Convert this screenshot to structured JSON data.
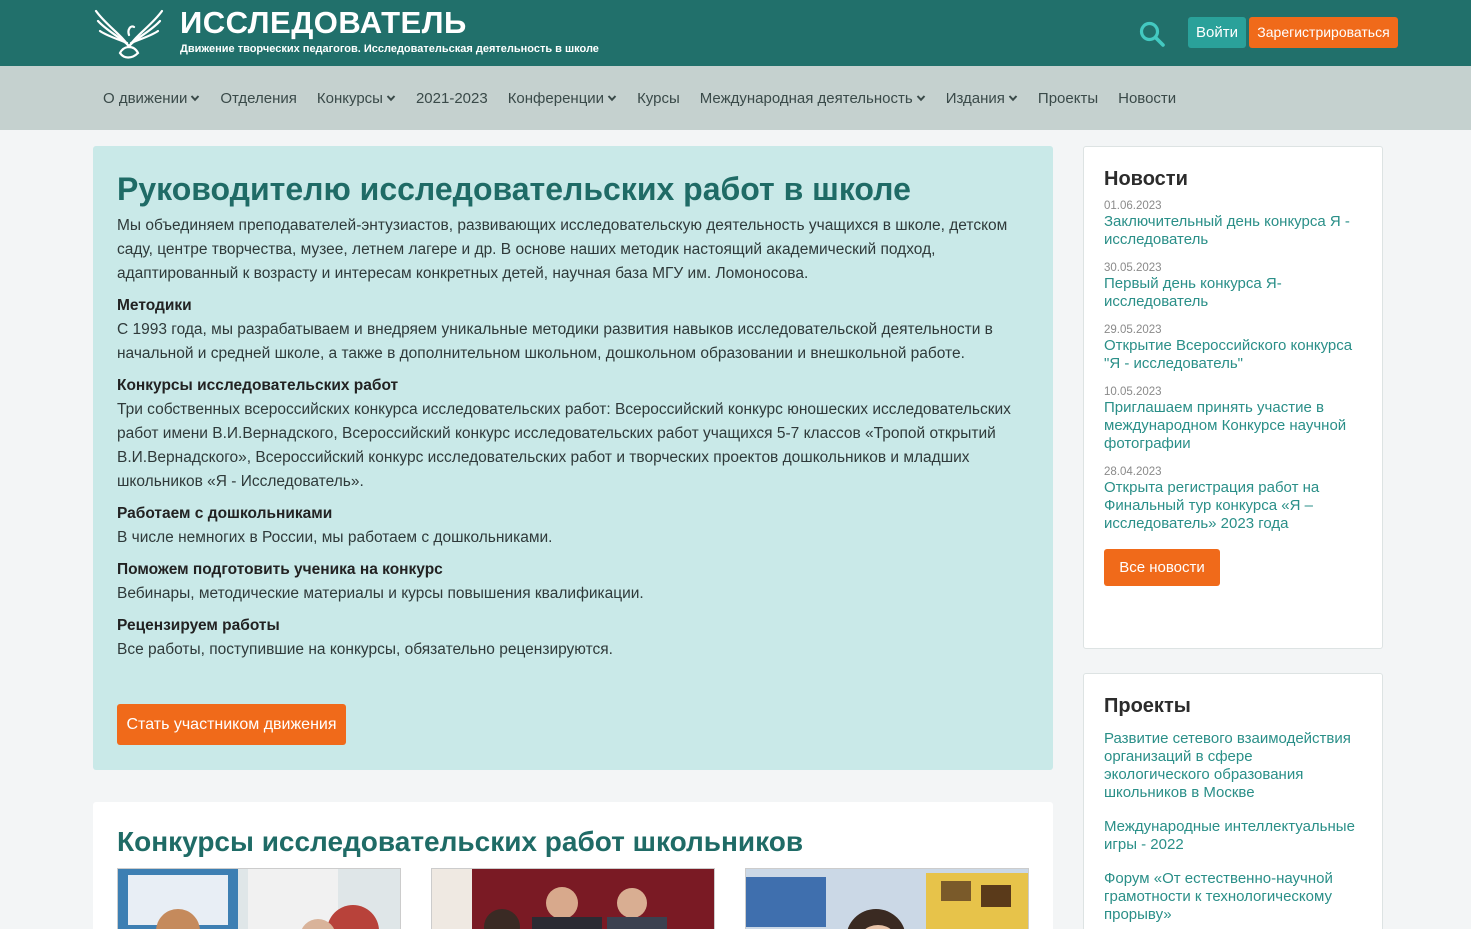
{
  "header": {
    "title": "ИССЛЕДОВАТЕЛЬ",
    "subtitle": "Движение творческих педагогов. Исследовательская деятельность в школе",
    "login": "Войти",
    "register": "Зарегистрироваться"
  },
  "nav": [
    {
      "label": "О движении",
      "dropdown": true
    },
    {
      "label": "Отделения",
      "dropdown": false
    },
    {
      "label": "Конкурсы",
      "dropdown": true
    },
    {
      "label": "2021-2023",
      "dropdown": false
    },
    {
      "label": "Конференции",
      "dropdown": true
    },
    {
      "label": "Курсы",
      "dropdown": false
    },
    {
      "label": "Международная деятельность",
      "dropdown": true
    },
    {
      "label": "Издания",
      "dropdown": true
    },
    {
      "label": "Проекты",
      "dropdown": false
    },
    {
      "label": "Новости",
      "dropdown": false
    }
  ],
  "main": {
    "title": "Руководителю исследовательских работ в школе",
    "intro": "Мы объединяем преподавателей-энтузиастов, развивающих исследовательскую деятельность учащихся в школе, детском саду, центре творчества, музее, летнем лагере и др. В основе наших методик настоящий академический подход, адаптированный к возрасту и интересам конкретных детей, научная база МГУ им. Ломоносова.",
    "sections": [
      {
        "title": "Методики",
        "text": "С 1993 года, мы разрабатываем и внедряем уникальные методики развития навыков исследовательской деятельности в начальной и средней школе, а также в дополнительном школьном, дошкольном образовании и внешкольной работе."
      },
      {
        "title": "Конкурсы исследовательских работ",
        "text": "Три собственных всероссийских конкурса исследовательских работ: Всероссийский конкурс юношеских исследовательских работ имени В.И.Вернадского, Всероссийский конкурс исследовательских работ учащихся 5-7 классов «Тропой открытий В.И.Вернадского», Всероссийский конкурс исследовательских работ и творческих проектов дошкольников и младших школьников «Я - Исследователь»."
      },
      {
        "title": "Работаем с дошкольниками",
        "text": "В числе немногих в России, мы работаем с дошкольниками."
      },
      {
        "title": "Поможем подготовить ученика на конкурс",
        "text": "Вебинары, методические материалы и курсы повышения квалификации."
      },
      {
        "title": "Рецензируем работы",
        "text": "Все работы, поступившие на конкурсы, обязательно рецензируются."
      }
    ],
    "join_button": "Стать участником движения"
  },
  "contests": {
    "title": "Конкурсы исследовательских работ школьников"
  },
  "news": {
    "title": "Новости",
    "items": [
      {
        "date": "01.06.2023",
        "text": "Заключительный день конкурса Я - исследователь"
      },
      {
        "date": "30.05.2023",
        "text": "Первый день конкурса Я-исследователь"
      },
      {
        "date": "29.05.2023",
        "text": "Открытие Всероссийского конкурса \"Я - исследователь\""
      },
      {
        "date": "10.05.2023",
        "text": "Приглашаем принять участие в международном Конкурсе научной фотографии"
      },
      {
        "date": "28.04.2023",
        "text": "Открыта регистрация работ на Финальный тур конкурса «Я – исследователь» 2023 года"
      }
    ],
    "all_button": "Все новости"
  },
  "projects": {
    "title": "Проекты",
    "items": [
      "Развитие сетевого взаимодействия организаций в сфере экологического образования школьников в Москве",
      "Международные интеллектуальные игры - 2022",
      "Форум «От естественно-научной грамотности к технологическому прорыву»"
    ]
  },
  "colors": {
    "header_bg": "#21706b",
    "nav_bg": "#c5d1cf",
    "accent": "#f06a1a",
    "teal": "#2aa19a",
    "card_bg": "#c9e9e8",
    "link": "#2a8f88"
  }
}
